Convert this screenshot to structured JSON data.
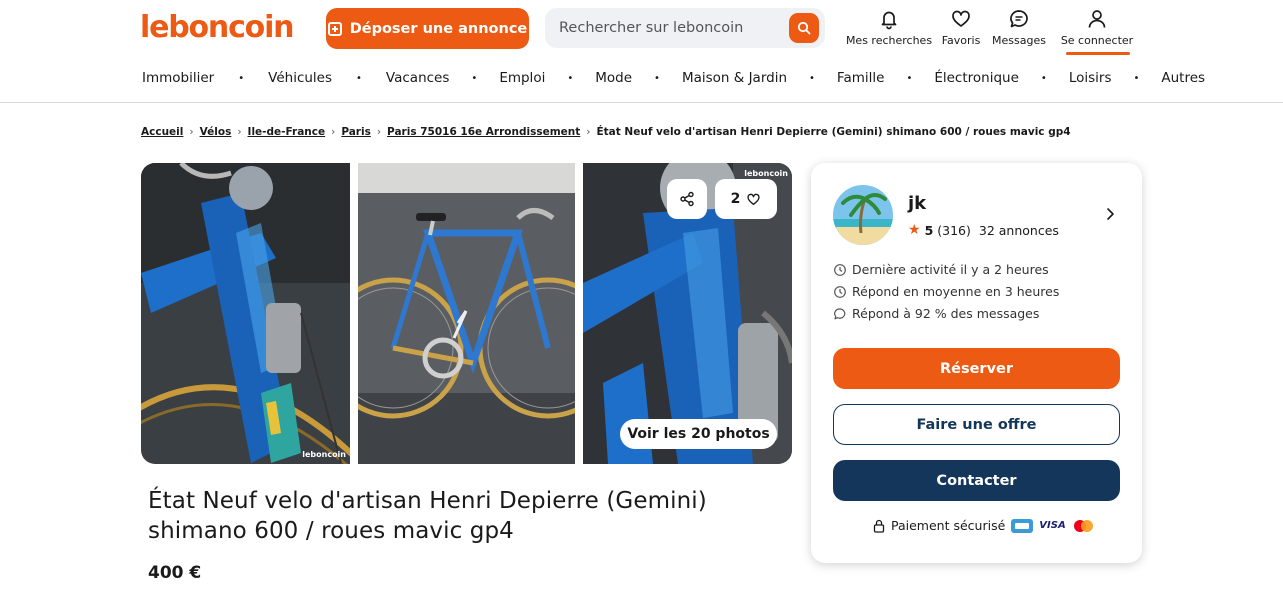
{
  "header": {
    "logo": "leboncoin",
    "post_button": "Déposer une annonce",
    "search_placeholder": "Rechercher sur leboncoin",
    "nav": {
      "searches": "Mes recherches",
      "favorites": "Favoris",
      "messages": "Messages",
      "login": "Se connecter"
    },
    "categories": [
      "Immobilier",
      "Véhicules",
      "Vacances",
      "Emploi",
      "Mode",
      "Maison & Jardin",
      "Famille",
      "Électronique",
      "Loisirs",
      "Autres"
    ]
  },
  "breadcrumb": [
    "Accueil",
    "Vélos",
    "Ile-de-France",
    "Paris",
    "Paris 75016 16e Arrondissement",
    "État Neuf velo d'artisan Henri Depierre (Gemini) shimano 600 / roues mavic gp4"
  ],
  "gallery": {
    "favorite_count": "2",
    "see_photos": "Voir les 20 photos",
    "watermark": "leboncoin"
  },
  "listing": {
    "title": "État Neuf velo d'artisan Henri Depierre (Gemini) shimano 600 / roues mavic gp4",
    "price": "400 €"
  },
  "seller": {
    "name": "jk",
    "rating": "5",
    "reviews": "(316)",
    "ads": "32 annonces",
    "last_activity": "Dernière activité il y a 2 heures",
    "response_time": "Répond en moyenne en 3 heures",
    "response_rate": "Répond à 92 % des messages",
    "reserve": "Réserver",
    "offer": "Faire une offre",
    "contact": "Contacter",
    "secure_payment": "Paiement sécurisé",
    "visa": "VISA"
  },
  "colors": {
    "brand": "#ec5a13",
    "navy": "#14365a"
  }
}
